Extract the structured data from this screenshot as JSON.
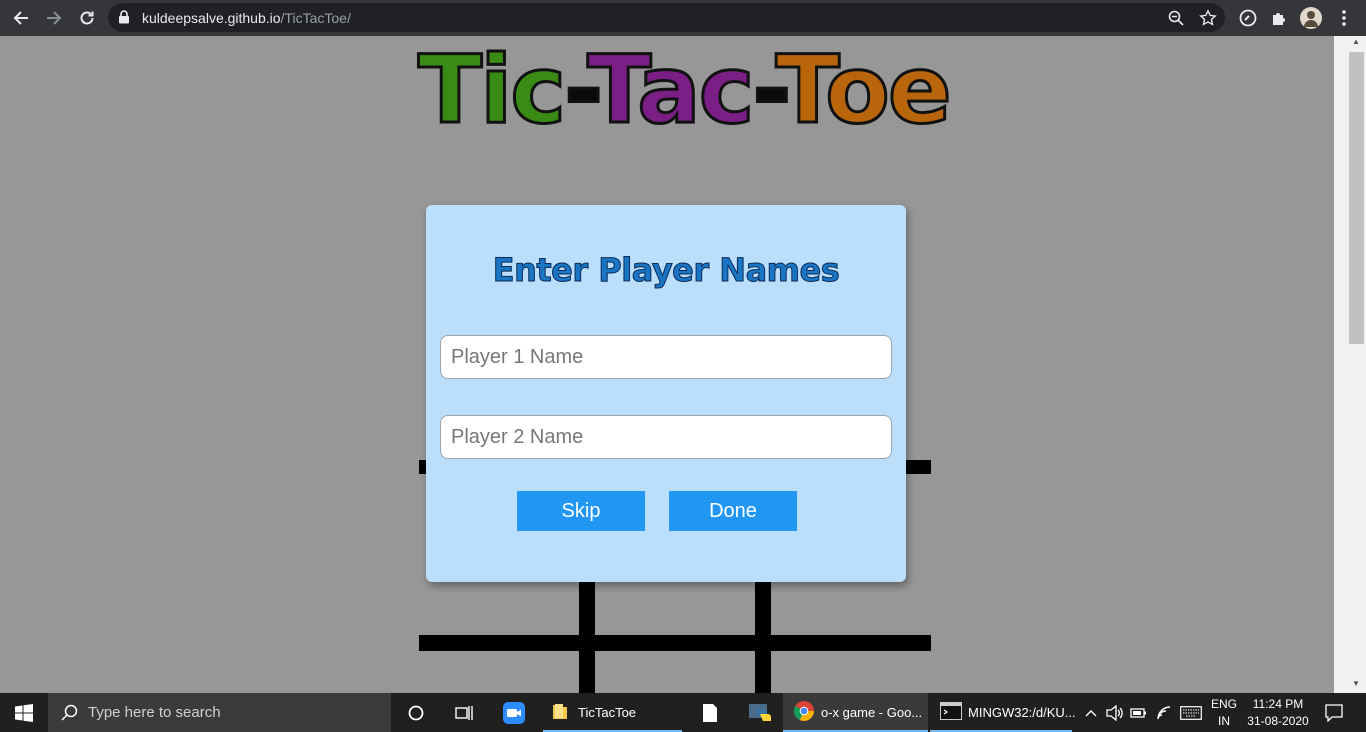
{
  "browser": {
    "url_domain": "kuldeepsalve.github.io",
    "url_path": "/TicTacToe/",
    "icons": [
      "back-arrow-icon",
      "forward-arrow-icon",
      "reload-icon",
      "lock-icon",
      "zoom-icon",
      "star-icon",
      "extension-icon",
      "puzzle-icon",
      "profile-avatar",
      "menu-dots-icon"
    ]
  },
  "page": {
    "title_parts": [
      {
        "text": "Tic",
        "color": "#3a8a16"
      },
      {
        "text": "-",
        "color": "#0b0b0b"
      },
      {
        "text": "Tac",
        "color": "#7b1f86"
      },
      {
        "text": "-",
        "color": "#0b0b0b"
      },
      {
        "text": "Toe",
        "color": "#b8650c"
      }
    ],
    "modal": {
      "heading": "Enter Player Names",
      "player1_placeholder": "Player 1 Name",
      "player2_placeholder": "Player 2 Name",
      "player1_value": "",
      "player2_value": "",
      "skip_label": "Skip",
      "done_label": "Done",
      "accent": "#2196f3",
      "background": "#bbdefa"
    }
  },
  "taskbar": {
    "search_placeholder": "Type here to search",
    "apps": [
      {
        "label": "TicTacToe",
        "icon": "folder-icon"
      },
      {
        "label": "o-x game - Goo...",
        "icon": "chrome-icon"
      },
      {
        "label": "MINGW32:/d/KU...",
        "icon": "terminal-icon"
      }
    ],
    "tray": {
      "lang_top": "ENG",
      "lang_bottom": "IN",
      "time": "11:24 PM",
      "date": "31-08-2020"
    }
  }
}
